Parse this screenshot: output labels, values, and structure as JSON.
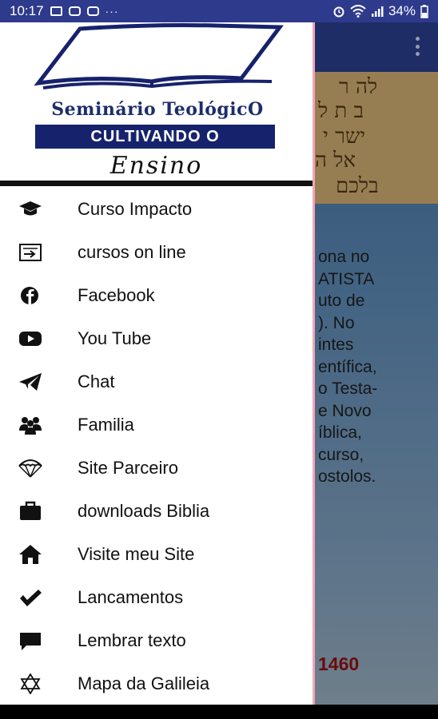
{
  "status_bar": {
    "time": "10:17",
    "more": "···",
    "battery": "34%",
    "icons": [
      "image-icon",
      "youtube-icon",
      "youtube-icon",
      "alarm-icon",
      "wifi-icon",
      "signal-icon",
      "battery-icon"
    ]
  },
  "logo": {
    "line1": "Seminário TeológicO",
    "line2": "CULTIVANDO O",
    "line3": "Ensino"
  },
  "menu": {
    "items": [
      {
        "label": "Curso Impacto",
        "icon": "graduation-cap-icon"
      },
      {
        "label": "cursos on line",
        "icon": "card-arrow-icon"
      },
      {
        "label": "Facebook",
        "icon": "facebook-icon"
      },
      {
        "label": "You Tube",
        "icon": "youtube-icon"
      },
      {
        "label": "Chat",
        "icon": "paper-plane-icon"
      },
      {
        "label": "Familia",
        "icon": "group-icon"
      },
      {
        "label": "Site Parceiro",
        "icon": "parachute-icon"
      },
      {
        "label": "downloads Biblia",
        "icon": "briefcase-icon"
      },
      {
        "label": "Visite meu Site",
        "icon": "home-icon"
      },
      {
        "label": "Lancamentos",
        "icon": "checkmark-icon"
      },
      {
        "label": "Lembrar texto",
        "icon": "chat-bubble-icon"
      },
      {
        "label": "Mapa da Galileia",
        "icon": "star-of-david-icon"
      }
    ]
  },
  "background": {
    "text_lines": [
      "ona no",
      "ATISTA",
      "uto de",
      "). No",
      "intes",
      "entífica,",
      "o Testa-",
      "e Novo",
      "íblica,",
      " curso,",
      "ostolos."
    ],
    "number": "1460",
    "hebrew_lines": [
      "לה ר",
      "ב ת ל",
      "ישר י",
      "אל ה",
      "בלכם"
    ]
  },
  "colors": {
    "status_bar": "#2e3a8c",
    "toolbar": "#2a3c8a",
    "logo_navy": "#16226b",
    "drawer_edge": "#f0a8b8",
    "number_red": "#8a1010"
  }
}
